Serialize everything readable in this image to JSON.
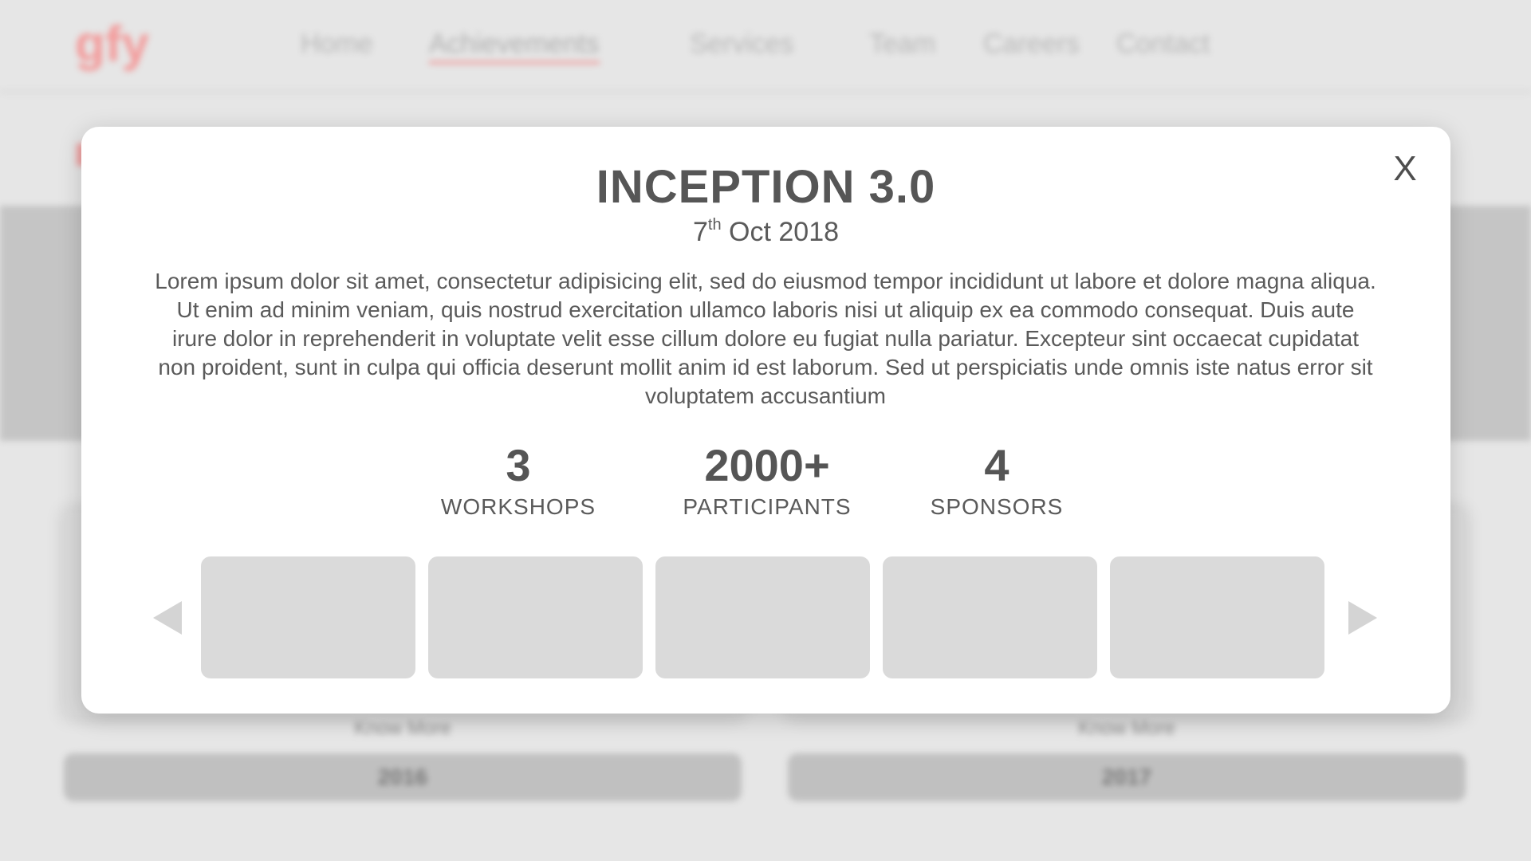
{
  "nav": {
    "logo_text": "gfy",
    "items": [
      "Home",
      "Achievements",
      "Services",
      "Team",
      "Careers",
      "Contact"
    ],
    "active": "Achievements"
  },
  "background_cards": [
    {
      "link": "Know More",
      "year": "2016"
    },
    {
      "link": "Know More",
      "year": "2017"
    }
  ],
  "modal": {
    "title": "INCEPTION 3.0",
    "date_day": "7",
    "date_suffix": "th",
    "date_rest": " Oct 2018",
    "close_label": "X",
    "description": "Lorem ipsum dolor sit amet, consectetur adipisicing elit, sed do eiusmod tempor incididunt ut labore et dolore magna aliqua. Ut enim ad minim veniam, quis nostrud exercitation ullamco laboris nisi ut aliquip ex ea commodo consequat. Duis aute irure dolor in reprehenderit in voluptate velit esse cillum dolore eu fugiat nulla pariatur. Excepteur sint occaecat cupidatat non proident, sunt in culpa qui officia deserunt mollit anim id est laborum. Sed ut perspiciatis unde omnis iste natus error sit voluptatem accusantium",
    "stats": [
      {
        "value": "3",
        "label": "WORKSHOPS"
      },
      {
        "value": "2000+",
        "label": "PARTICIPANTS"
      },
      {
        "value": "4",
        "label": "SPONSORS"
      }
    ],
    "gallery_count": 5,
    "colors": {
      "overlay_bg": "#e6e6e6",
      "card": "#ffffff",
      "text": "#565656",
      "placeholder": "#dadada",
      "accent": "#f08a8a"
    }
  }
}
